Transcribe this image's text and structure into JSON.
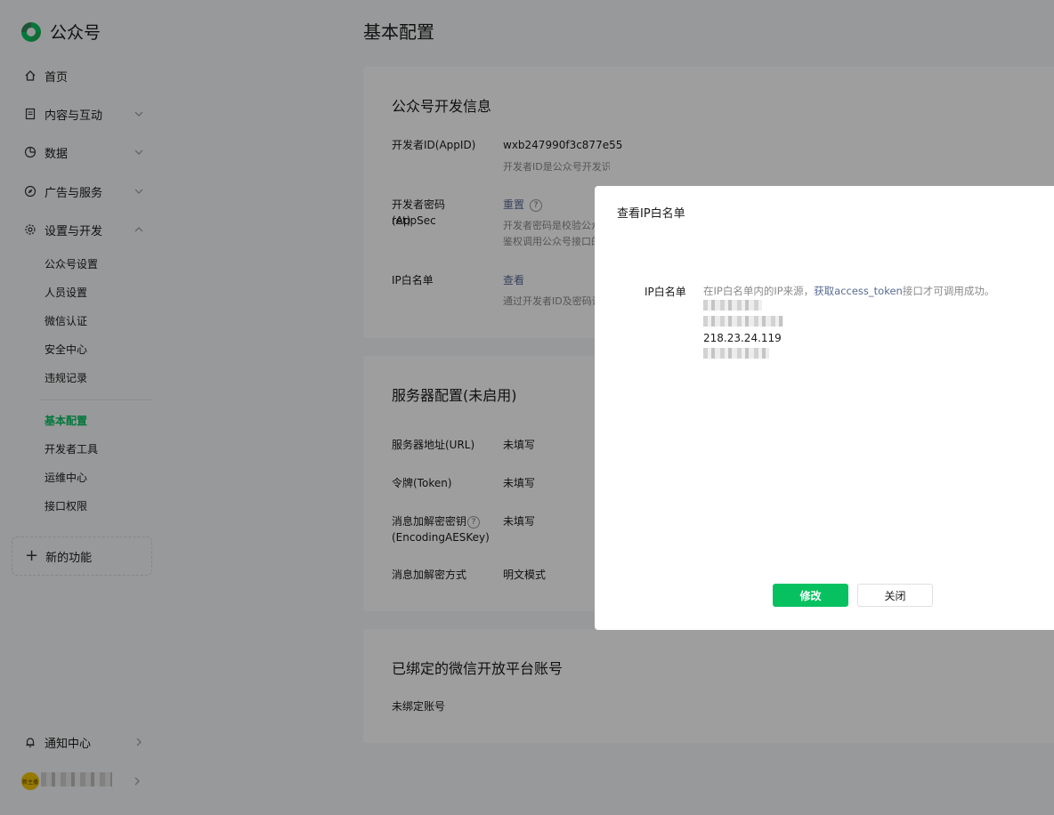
{
  "app": {
    "name": "公众号"
  },
  "sidebar": {
    "items": [
      {
        "label": "首页",
        "icon": "home-icon"
      },
      {
        "label": "内容与互动",
        "icon": "document-icon"
      },
      {
        "label": "数据",
        "icon": "pie-chart-icon"
      },
      {
        "label": "广告与服务",
        "icon": "compass-icon"
      },
      {
        "label": "设置与开发",
        "icon": "gear-icon"
      }
    ],
    "sub_items_group1": [
      "公众号设置",
      "人员设置",
      "微信认证",
      "安全中心",
      "违规记录"
    ],
    "sub_items_group2": [
      "基本配置",
      "开发者工具",
      "运维中心",
      "接口权限"
    ],
    "active_sub_item": "基本配置",
    "new_feature": "新的功能",
    "notification": "通知中心",
    "avatar_text": "新主播"
  },
  "main": {
    "page_title": "基本配置",
    "dev_card": {
      "title": "公众号开发信息",
      "appid_label": "开发者ID(AppID)",
      "appid_value": "wxb247990f3c877e55",
      "appid_desc": "开发者ID是公众号开发识别码，配合开发者密码可调用公众号的接口能力。",
      "secret_label_1": "开发者密码(AppSec",
      "secret_label_2": "ret)",
      "secret_action": "重置",
      "secret_desc_1": "开发者密码是校验公众",
      "secret_desc_2": "鉴权调用公众号接口的",
      "ip_label": "IP白名单",
      "ip_action": "查看",
      "ip_desc": "通过开发者ID及密码调"
    },
    "server_card": {
      "title": "服务器配置(未启用)",
      "rows": [
        {
          "label": "服务器地址(URL)",
          "value": "未填写"
        },
        {
          "label": "令牌(Token)",
          "value": "未填写"
        },
        {
          "label": "消息加解密密钥",
          "label2": "(EncodingAESKey)",
          "value": "未填写"
        },
        {
          "label": "消息加解密方式",
          "value": "明文模式"
        }
      ]
    },
    "bind_card": {
      "title": "已绑定的微信开放平台账号",
      "status": "未绑定账号"
    }
  },
  "modal": {
    "title": "查看IP白名单",
    "label": "IP白名单",
    "desc_prefix": "在IP白名单内的IP来源，",
    "desc_link": "获取access_token",
    "desc_suffix": "接口才可调用成功。",
    "ip_visible": "218.23.24.119",
    "primary_button": "修改",
    "secondary_button": "关闭"
  },
  "colors": {
    "accent": "#07c160",
    "link": "#576b95",
    "overlay": "rgba(0,0,0,0.38)"
  }
}
